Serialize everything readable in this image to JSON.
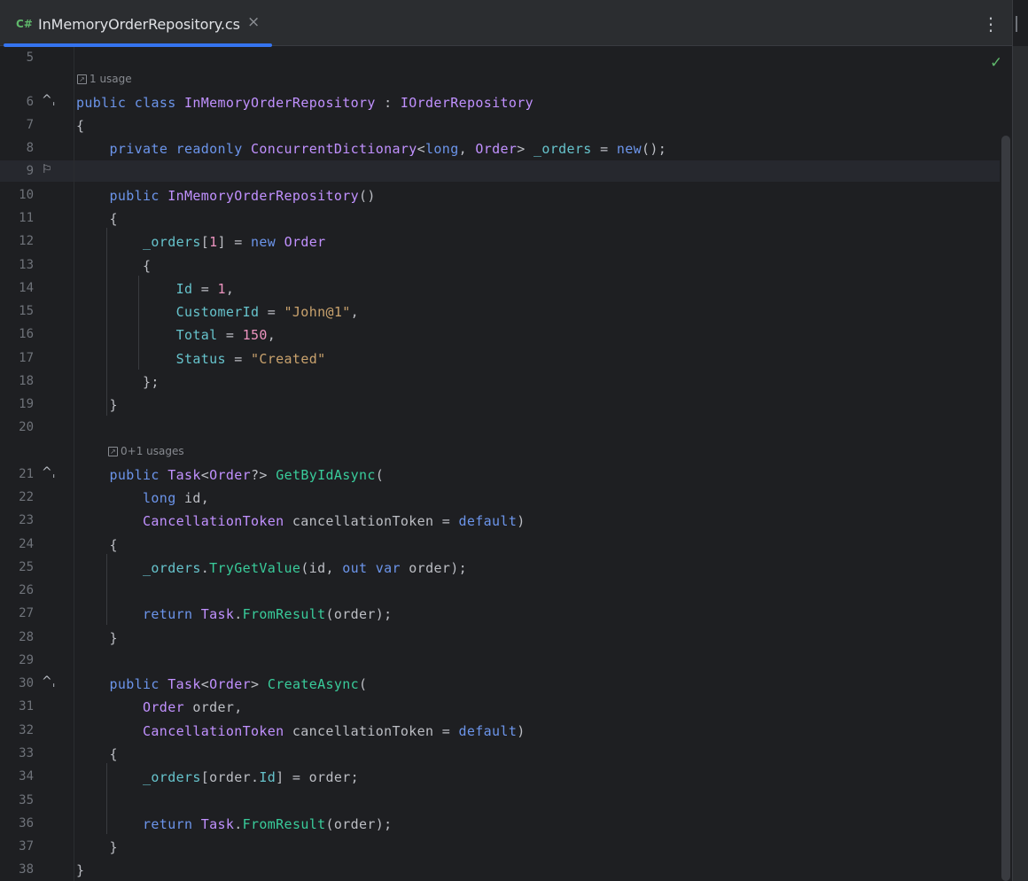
{
  "tab": {
    "language_icon": "C#",
    "title": "InMemoryOrderRepository.cs",
    "close_glyph": "×"
  },
  "toolbar": {
    "more_glyph": "⋮"
  },
  "status": {
    "check_glyph": "✓"
  },
  "hints": {
    "class_usages": "1 usage",
    "method_usages": "0+1 usages",
    "icon_glyph": "↗"
  },
  "colors": {
    "accent": "#3574f0",
    "keyword": "#6c95eb",
    "type": "#c191ff",
    "field": "#66c3cc",
    "number": "#ed94c0",
    "string": "#c9a26d",
    "method": "#39cc9b",
    "check": "#5fb86b"
  },
  "lines": [
    {
      "n": "5",
      "tokens": []
    },
    {
      "n": "6",
      "gutter": "up-arrow-icon",
      "tokens": [
        [
          "k",
          "public"
        ],
        [
          "p",
          " "
        ],
        [
          "k",
          "class"
        ],
        [
          "p",
          " "
        ],
        [
          "c",
          "InMemoryOrderRepository"
        ],
        [
          "p",
          " : "
        ],
        [
          "c",
          "IOrderRepository"
        ]
      ]
    },
    {
      "n": "7",
      "tokens": [
        [
          "p",
          "{"
        ]
      ]
    },
    {
      "n": "8",
      "tokens": [
        [
          "p",
          "    "
        ],
        [
          "k",
          "private"
        ],
        [
          "p",
          " "
        ],
        [
          "k",
          "readonly"
        ],
        [
          "p",
          " "
        ],
        [
          "c",
          "ConcurrentDictionary"
        ],
        [
          "p",
          "<"
        ],
        [
          "k",
          "long"
        ],
        [
          "p",
          ", "
        ],
        [
          "c",
          "Order"
        ],
        [
          "p",
          "> "
        ],
        [
          "f",
          "_orders"
        ],
        [
          "p",
          " = "
        ],
        [
          "k",
          "new"
        ],
        [
          "p",
          "();"
        ]
      ]
    },
    {
      "n": "9",
      "gutter": "lightbulb-icon",
      "tokens": []
    },
    {
      "n": "10",
      "tokens": [
        [
          "p",
          "    "
        ],
        [
          "k",
          "public"
        ],
        [
          "p",
          " "
        ],
        [
          "c",
          "InMemoryOrderRepository"
        ],
        [
          "p",
          "()"
        ]
      ]
    },
    {
      "n": "11",
      "tokens": [
        [
          "p",
          "    {"
        ]
      ]
    },
    {
      "n": "12",
      "tokens": [
        [
          "p",
          "        "
        ],
        [
          "f",
          "_orders"
        ],
        [
          "p",
          "["
        ],
        [
          "n",
          "1"
        ],
        [
          "p",
          "] = "
        ],
        [
          "k",
          "new"
        ],
        [
          "p",
          " "
        ],
        [
          "c",
          "Order"
        ]
      ]
    },
    {
      "n": "13",
      "tokens": [
        [
          "p",
          "        {"
        ]
      ]
    },
    {
      "n": "14",
      "tokens": [
        [
          "p",
          "            "
        ],
        [
          "f",
          "Id"
        ],
        [
          "p",
          " = "
        ],
        [
          "n",
          "1"
        ],
        [
          "p",
          ","
        ]
      ]
    },
    {
      "n": "15",
      "tokens": [
        [
          "p",
          "            "
        ],
        [
          "f",
          "CustomerId"
        ],
        [
          "p",
          " = "
        ],
        [
          "s",
          "\"John@1\""
        ],
        [
          "p",
          ","
        ]
      ]
    },
    {
      "n": "16",
      "tokens": [
        [
          "p",
          "            "
        ],
        [
          "f",
          "Total"
        ],
        [
          "p",
          " = "
        ],
        [
          "n",
          "150"
        ],
        [
          "p",
          ","
        ]
      ]
    },
    {
      "n": "17",
      "tokens": [
        [
          "p",
          "            "
        ],
        [
          "f",
          "Status"
        ],
        [
          "p",
          " = "
        ],
        [
          "s",
          "\"Created\""
        ]
      ]
    },
    {
      "n": "18",
      "tokens": [
        [
          "p",
          "        };"
        ]
      ]
    },
    {
      "n": "19",
      "tokens": [
        [
          "p",
          "    }"
        ]
      ]
    },
    {
      "n": "20",
      "tokens": []
    },
    {
      "n": "21",
      "gutter": "up-arrow-icon",
      "tokens": [
        [
          "p",
          "    "
        ],
        [
          "k",
          "public"
        ],
        [
          "p",
          " "
        ],
        [
          "c",
          "Task"
        ],
        [
          "p",
          "<"
        ],
        [
          "c",
          "Order"
        ],
        [
          "p",
          "?> "
        ],
        [
          "m",
          "GetByIdAsync"
        ],
        [
          "p",
          "("
        ]
      ]
    },
    {
      "n": "22",
      "tokens": [
        [
          "p",
          "        "
        ],
        [
          "k",
          "long"
        ],
        [
          "p",
          " id,"
        ]
      ]
    },
    {
      "n": "23",
      "tokens": [
        [
          "p",
          "        "
        ],
        [
          "c",
          "CancellationToken"
        ],
        [
          "p",
          " cancellationToken = "
        ],
        [
          "k",
          "default"
        ],
        [
          "p",
          ")"
        ]
      ]
    },
    {
      "n": "24",
      "tokens": [
        [
          "p",
          "    {"
        ]
      ]
    },
    {
      "n": "25",
      "tokens": [
        [
          "p",
          "        "
        ],
        [
          "f",
          "_orders"
        ],
        [
          "p",
          "."
        ],
        [
          "m",
          "TryGetValue"
        ],
        [
          "p",
          "(id, "
        ],
        [
          "k",
          "out"
        ],
        [
          "p",
          " "
        ],
        [
          "k",
          "var"
        ],
        [
          "p",
          " order);"
        ]
      ]
    },
    {
      "n": "26",
      "tokens": []
    },
    {
      "n": "27",
      "tokens": [
        [
          "p",
          "        "
        ],
        [
          "k",
          "return"
        ],
        [
          "p",
          " "
        ],
        [
          "c",
          "Task"
        ],
        [
          "p",
          "."
        ],
        [
          "m",
          "FromResult"
        ],
        [
          "p",
          "(order);"
        ]
      ]
    },
    {
      "n": "28",
      "tokens": [
        [
          "p",
          "    }"
        ]
      ]
    },
    {
      "n": "29",
      "tokens": []
    },
    {
      "n": "30",
      "gutter": "up-arrow-icon",
      "tokens": [
        [
          "p",
          "    "
        ],
        [
          "k",
          "public"
        ],
        [
          "p",
          " "
        ],
        [
          "c",
          "Task"
        ],
        [
          "p",
          "<"
        ],
        [
          "c",
          "Order"
        ],
        [
          "p",
          "> "
        ],
        [
          "m",
          "CreateAsync"
        ],
        [
          "p",
          "("
        ]
      ]
    },
    {
      "n": "31",
      "tokens": [
        [
          "p",
          "        "
        ],
        [
          "c",
          "Order"
        ],
        [
          "p",
          " order,"
        ]
      ]
    },
    {
      "n": "32",
      "tokens": [
        [
          "p",
          "        "
        ],
        [
          "c",
          "CancellationToken"
        ],
        [
          "p",
          " cancellationToken = "
        ],
        [
          "k",
          "default"
        ],
        [
          "p",
          ")"
        ]
      ]
    },
    {
      "n": "33",
      "tokens": [
        [
          "p",
          "    {"
        ]
      ]
    },
    {
      "n": "34",
      "tokens": [
        [
          "p",
          "        "
        ],
        [
          "f",
          "_orders"
        ],
        [
          "p",
          "[order."
        ],
        [
          "f",
          "Id"
        ],
        [
          "p",
          "] = order;"
        ]
      ]
    },
    {
      "n": "35",
      "tokens": []
    },
    {
      "n": "36",
      "tokens": [
        [
          "p",
          "        "
        ],
        [
          "k",
          "return"
        ],
        [
          "p",
          " "
        ],
        [
          "c",
          "Task"
        ],
        [
          "p",
          "."
        ],
        [
          "m",
          "FromResult"
        ],
        [
          "p",
          "(order);"
        ]
      ]
    },
    {
      "n": "37",
      "tokens": [
        [
          "p",
          "    }"
        ]
      ]
    },
    {
      "n": "38",
      "tokens": [
        [
          "p",
          "}"
        ]
      ]
    }
  ]
}
